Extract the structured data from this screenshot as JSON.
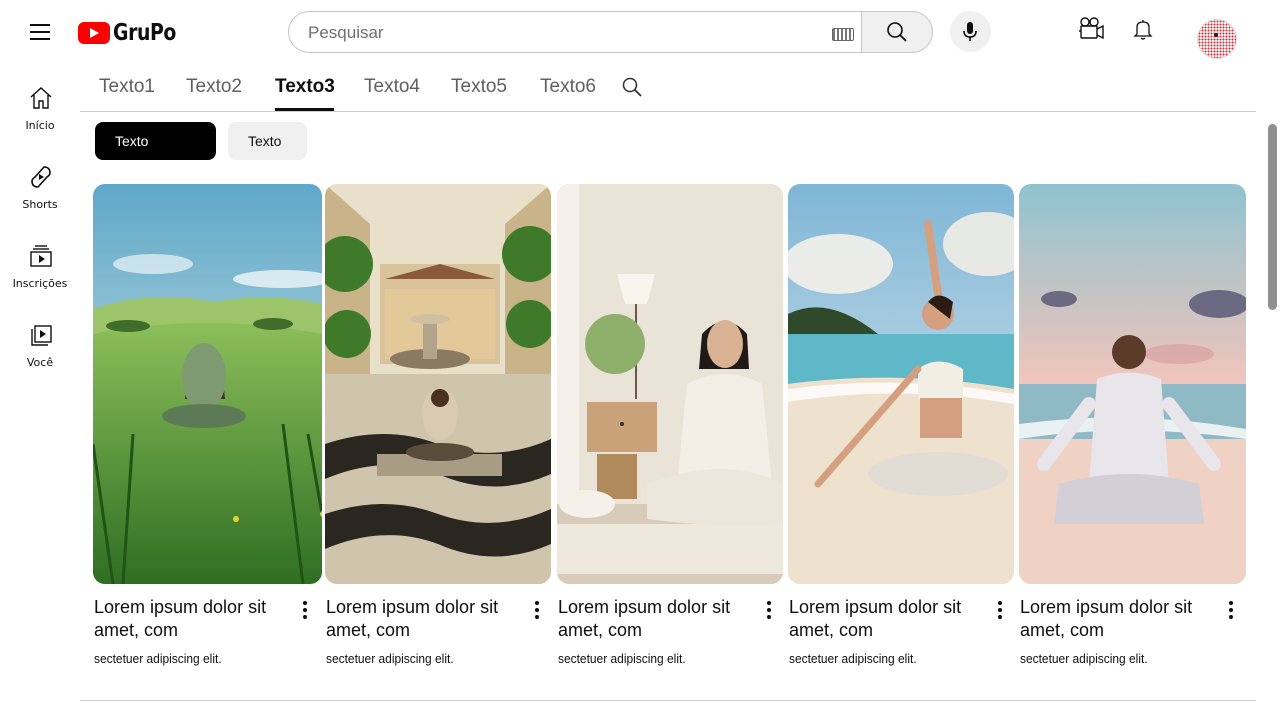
{
  "header": {
    "logo_text": "GruPo",
    "search_placeholder": "Pesquisar",
    "icons": [
      "menu-icon",
      "play-logo-icon",
      "keyboard-icon",
      "search-icon",
      "microphone-icon",
      "create-video-icon",
      "bell-icon"
    ]
  },
  "sidebar": {
    "items": [
      {
        "label": "Início",
        "icon": "home-icon"
      },
      {
        "label": "Shorts",
        "icon": "shorts-icon"
      },
      {
        "label": "Inscrições",
        "icon": "subscriptions-icon"
      },
      {
        "label": "Você",
        "icon": "you-icon"
      }
    ]
  },
  "tabs": {
    "items": [
      "Texto1",
      "Texto2",
      "Texto3",
      "Texto4",
      "Texto5",
      "Texto6"
    ],
    "active": "Texto3"
  },
  "chips": [
    "Texto",
    "Texto"
  ],
  "cards": [
    {
      "title": "Lorem ipsum dolor sit amet, com",
      "subtitle": "sectetuer adipiscing  elit.",
      "scene": "meditation-in-green-field"
    },
    {
      "title": "Lorem ipsum dolor sit amet, com",
      "subtitle": "sectetuer adipiscing  elit.",
      "scene": "meditation-in-plaza-with-fountain"
    },
    {
      "title": "Lorem ipsum dolor sit amet, com",
      "subtitle": "sectetuer adipiscing  elit.",
      "scene": "meditation-in-living-room"
    },
    {
      "title": "Lorem ipsum dolor sit amet, com",
      "subtitle": "sectetuer adipiscing  elit.",
      "scene": "yoga-on-beach"
    },
    {
      "title": "Lorem ipsum dolor sit amet, com",
      "subtitle": "sectetuer adipiscing  elit.",
      "scene": "meditation-at-sunset-beach"
    }
  ],
  "colors": {
    "brand": "#ff0000",
    "text": "#0f0f0f",
    "muted": "#606060",
    "chip_active": "#000000",
    "chip_inactive": "#f0f0f0"
  }
}
